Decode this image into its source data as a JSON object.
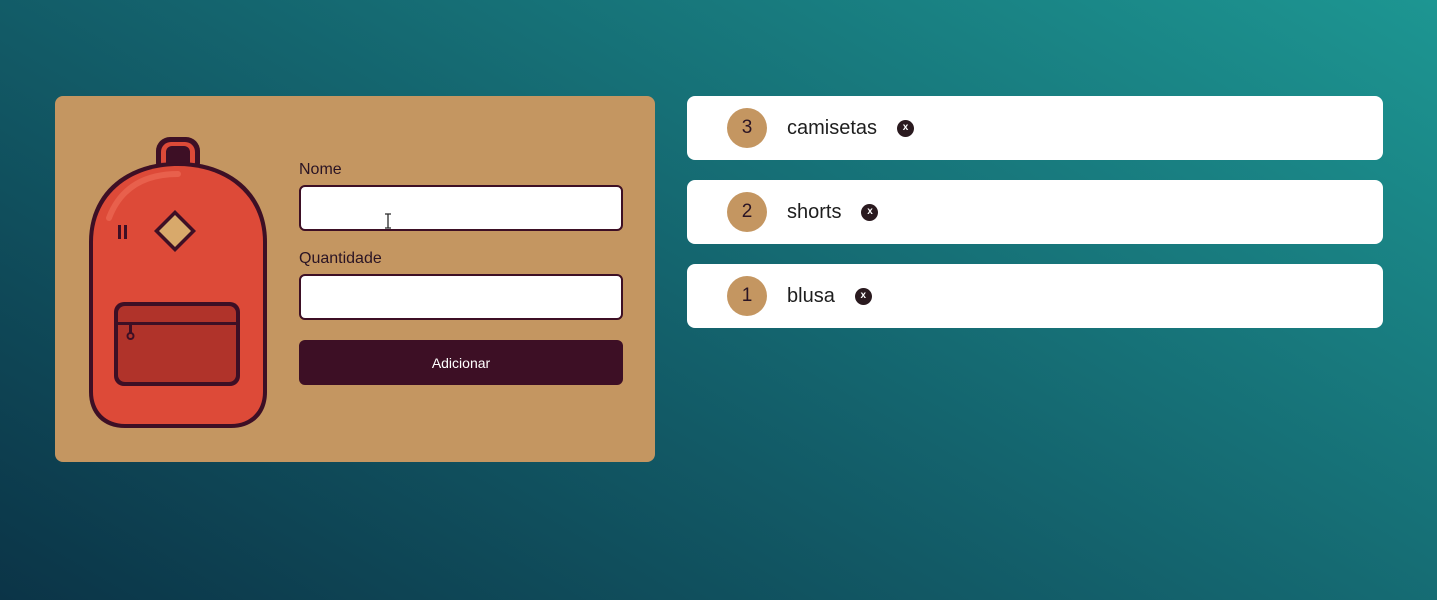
{
  "form": {
    "name_label": "Nome",
    "name_value": "",
    "quantity_label": "Quantidade",
    "quantity_value": "",
    "submit_label": "Adicionar"
  },
  "items": [
    {
      "quantity": "3",
      "name": "camisetas",
      "remove_icon": "x-circle-icon"
    },
    {
      "quantity": "2",
      "name": "shorts",
      "remove_icon": "x-circle-icon"
    },
    {
      "quantity": "1",
      "name": "blusa",
      "remove_icon": "x-circle-icon"
    }
  ],
  "colors": {
    "card": "#c49661",
    "button": "#3d0f25",
    "backpack_body": "#dd4a38",
    "outline": "#3d0f25"
  },
  "illustration": "backpack-icon"
}
